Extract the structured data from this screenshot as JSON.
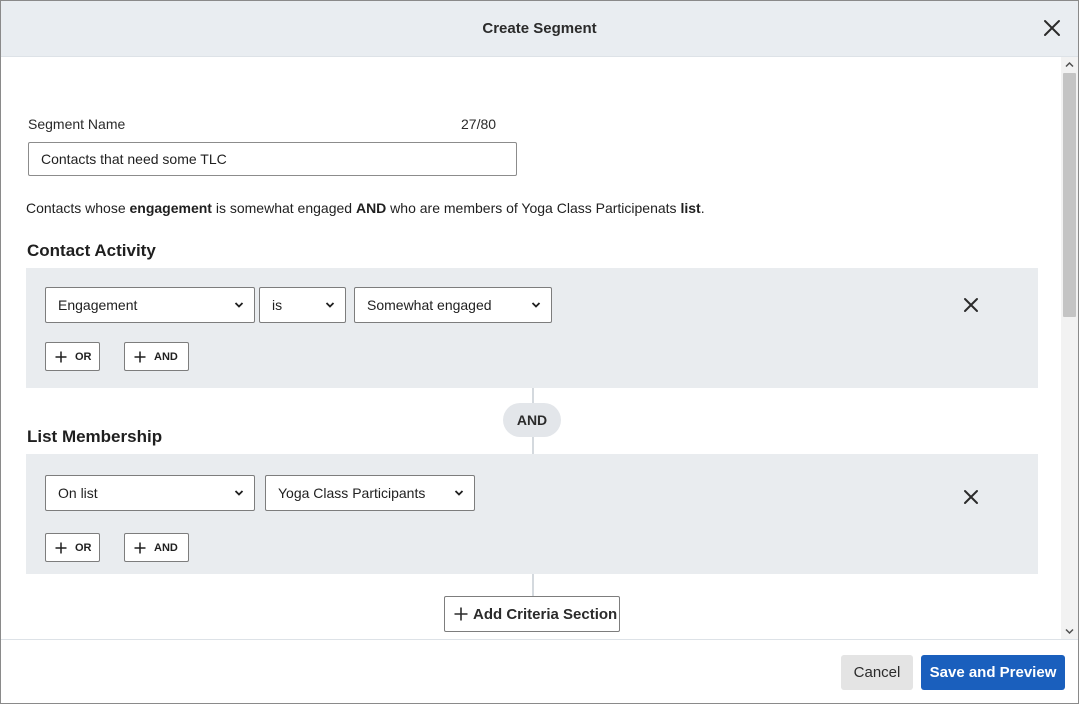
{
  "dialog": {
    "title": "Create Segment"
  },
  "segment_name": {
    "label": "Segment Name",
    "char_count": "27/80",
    "value": "Contacts that need some TLC"
  },
  "summary": {
    "part1": "Contacts whose ",
    "bold1": "engagement",
    "part2": " is somewhat engaged ",
    "bold2": "AND",
    "part3": " who are members of Yoga Class Participenats ",
    "bold3": "list",
    "part4": "."
  },
  "sections": [
    {
      "title": "Contact Activity",
      "selects": [
        "Engagement",
        "is",
        "Somewhat engaged"
      ],
      "or_label": "OR",
      "and_label": "AND"
    },
    {
      "title": "List Membership",
      "selects": [
        "On list",
        "Yoga Class Participants"
      ],
      "or_label": "OR",
      "and_label": "AND"
    }
  ],
  "connector_label": "AND",
  "add_criteria_label": "Add Criteria Section",
  "footer": {
    "cancel_label": "Cancel",
    "save_label": "Save and Preview"
  },
  "colors": {
    "header_bg": "#e9edf1",
    "panel_bg": "#e9ecef",
    "primary": "#1a5fbd"
  },
  "icons": [
    "close-icon",
    "chevron-down-icon",
    "plus-icon"
  ]
}
